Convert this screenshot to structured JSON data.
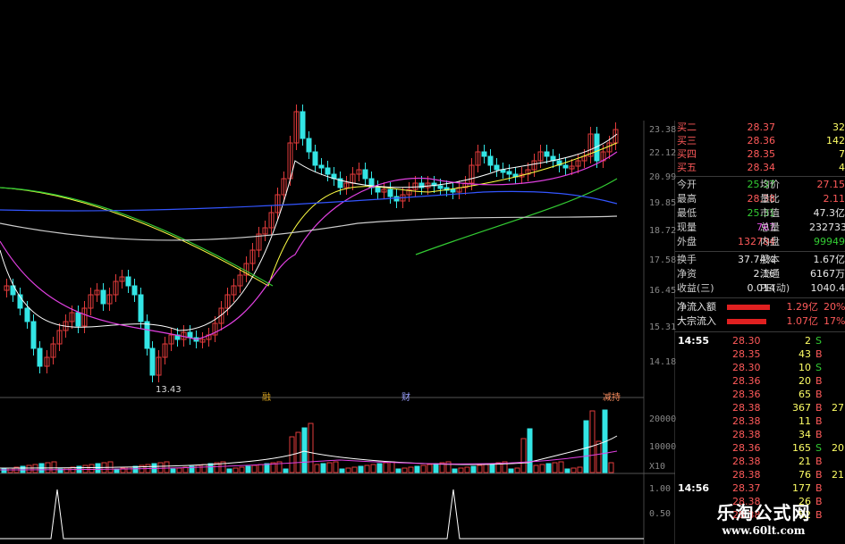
{
  "price_axis": [
    "23.38",
    "22.12",
    "20.99",
    "19.85",
    "18.72",
    "17.58",
    "16.45",
    "15.31",
    "14.18"
  ],
  "volume_axis": [
    "20000",
    "10000",
    "X10"
  ],
  "indicator_axis": [
    "1.00",
    "0.50"
  ],
  "low_marker": "13.43",
  "event_markers": [
    {
      "label": "融",
      "color": "#d4a020"
    },
    {
      "label": "财",
      "color": "#9aa0ff"
    },
    {
      "label": "减持",
      "color": "#ff9060"
    }
  ],
  "order_book": [
    {
      "label": "买二",
      "price": "28.37",
      "volume": "32"
    },
    {
      "label": "买三",
      "price": "28.36",
      "volume": "142"
    },
    {
      "label": "买四",
      "price": "28.35",
      "volume": "7"
    },
    {
      "label": "买五",
      "price": "28.34",
      "volume": "4"
    }
  ],
  "stats": [
    {
      "l1": "今开",
      "v1": "25.37",
      "v1c": "green",
      "l2": "均价",
      "v2": "27.15",
      "v2c": "red"
    },
    {
      "l1": "最高",
      "v1": "28.38",
      "v1c": "red",
      "l2": "量比",
      "v2": "2.11",
      "v2c": "red"
    },
    {
      "l1": "最低",
      "v1": "25.31",
      "v1c": "green",
      "l2": "市值",
      "v2": "47.3亿",
      "v2c": "white"
    },
    {
      "l1": "现量",
      "v1": "767",
      "v1c": "magenta",
      "l2": "总量",
      "v2": "232733",
      "v2c": "white"
    },
    {
      "l1": "外盘",
      "v1": "132784",
      "v1c": "red",
      "l2": "内盘",
      "v2": "99949",
      "v2c": "green"
    }
  ],
  "stats2": [
    {
      "l1": "换手",
      "v1": "37.74%",
      "v1c": "white",
      "l2": "股本",
      "v2": "1.67亿",
      "v2c": "white"
    },
    {
      "l1": "净资",
      "v1": "2.16",
      "v1c": "white",
      "l2": "流通",
      "v2": "6167万",
      "v2c": "white"
    },
    {
      "l1": "收益(三)",
      "v1": "0.014",
      "v1c": "white",
      "l2": "PE(动)",
      "v2": "1040.4",
      "v2c": "white"
    }
  ],
  "flows": [
    {
      "label": "净流入额",
      "value": "1.29亿",
      "pct": "20%"
    },
    {
      "label": "大宗流入",
      "value": "1.07亿",
      "pct": "17%"
    }
  ],
  "ticks": [
    {
      "time": "14:55",
      "price": "28.30",
      "vol": "2",
      "bs": "S",
      "extra": ""
    },
    {
      "time": "",
      "price": "28.35",
      "vol": "43",
      "bs": "B",
      "extra": ""
    },
    {
      "time": "",
      "price": "28.30",
      "vol": "10",
      "bs": "S",
      "extra": ""
    },
    {
      "time": "",
      "price": "28.36",
      "vol": "20",
      "bs": "B",
      "extra": ""
    },
    {
      "time": "",
      "price": "28.36",
      "vol": "65",
      "bs": "B",
      "extra": ""
    },
    {
      "time": "",
      "price": "28.38",
      "vol": "367",
      "bs": "B",
      "extra": "27"
    },
    {
      "time": "",
      "price": "28.38",
      "vol": "11",
      "bs": "B",
      "extra": ""
    },
    {
      "time": "",
      "price": "28.38",
      "vol": "34",
      "bs": "B",
      "extra": ""
    },
    {
      "time": "",
      "price": "28.36",
      "vol": "165",
      "bs": "S",
      "extra": "20"
    },
    {
      "time": "",
      "price": "28.38",
      "vol": "21",
      "bs": "B",
      "extra": ""
    },
    {
      "time": "",
      "price": "28.38",
      "vol": "76",
      "bs": "B",
      "extra": "21"
    },
    {
      "time": "14:56",
      "price": "28.37",
      "vol": "177",
      "bs": "B",
      "extra": ""
    },
    {
      "time": "",
      "price": "28.38",
      "vol": "26",
      "bs": "B",
      "extra": ""
    },
    {
      "time": "",
      "price": "28.38",
      "vol": "52",
      "bs": "B",
      "extra": ""
    }
  ],
  "watermark": {
    "title": "乐淘公式网",
    "url": "www.60lt.com"
  },
  "colors": {
    "up": "#e23b3b",
    "down": "#33e5e5",
    "ma5": "#ffffff",
    "ma10": "#ffff44",
    "ma20": "#e040e0",
    "ma30": "#33cc33",
    "ma60": "#3355ff",
    "ma120": "#cccccc"
  }
}
